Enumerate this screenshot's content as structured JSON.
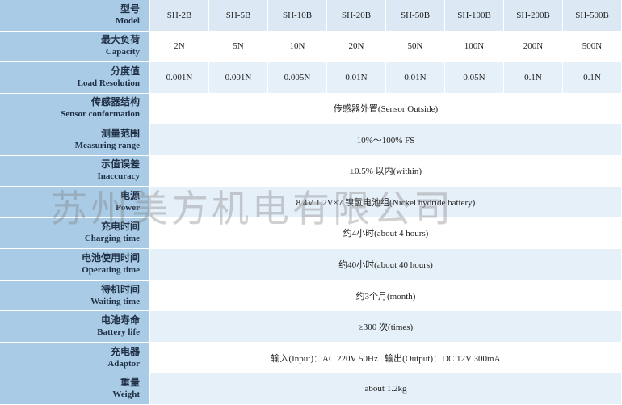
{
  "models": [
    "SH-2B",
    "SH-5B",
    "SH-10B",
    "SH-20B",
    "SH-50B",
    "SH-100B",
    "SH-200B",
    "SH-500B"
  ],
  "rows": [
    {
      "zh": "型号",
      "en": "Model"
    },
    {
      "zh": "最大负荷",
      "en": "Capacity",
      "values": [
        "2N",
        "5N",
        "10N",
        "20N",
        "50N",
        "100N",
        "200N",
        "500N"
      ]
    },
    {
      "zh": "分度值",
      "en": "Load Resolution",
      "values": [
        "0.001N",
        "0.001N",
        "0.005N",
        "0.01N",
        "0.01N",
        "0.05N",
        "0.1N",
        "0.1N"
      ]
    },
    {
      "zh": "传感器结构",
      "en": "Sensor conformation",
      "value": "传感器外置(Sensor Outside)"
    },
    {
      "zh": "测量范围",
      "en": "Measuring range",
      "value": "10%～100% FS"
    },
    {
      "zh": "示值误差",
      "en": "Inaccuracy",
      "value": "±0.5% 以内(within)"
    },
    {
      "zh": "电源",
      "en": "Power",
      "value": "8.4V 1.2V×7 镍氢电池组(Nickel hydride battery)"
    },
    {
      "zh": "充电时间",
      "en": "Charging time",
      "value": "约4小时(about 4 hours)"
    },
    {
      "zh": "电池使用时间",
      "en": "Operating time",
      "value": "约40小时(about 40 hours)"
    },
    {
      "zh": "待机时间",
      "en": "Waiting time",
      "value": "约3个月(month)"
    },
    {
      "zh": "电池寿命",
      "en": "Battery life",
      "value": "≥300 次(times)"
    },
    {
      "zh": "充电器",
      "en": "Adaptor",
      "value": "输入(Input)：AC 220V 50Hz   输出(Output)：DC 12V 300mA"
    },
    {
      "zh": "重量",
      "en": "Weight",
      "value": "about 1.2kg"
    }
  ],
  "watermark": "苏州美方机电有限公司"
}
